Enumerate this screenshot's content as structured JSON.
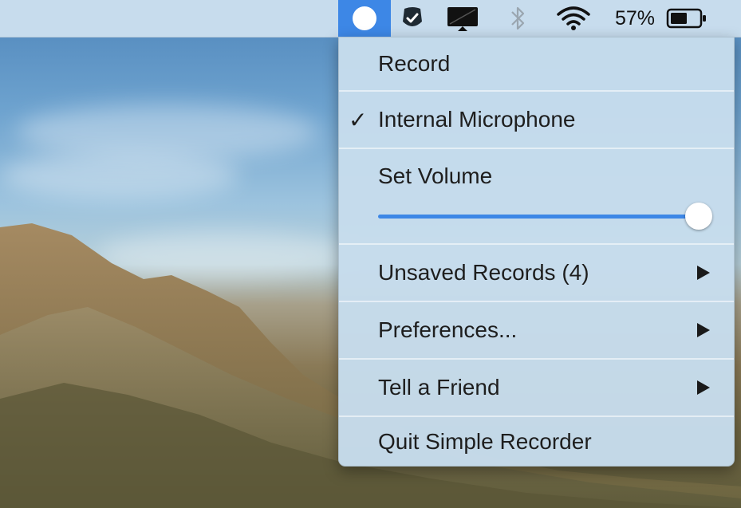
{
  "menubar": {
    "battery_percent": "57%",
    "icons": [
      "simple-recorder-icon",
      "checkmark-shield-icon",
      "display-icon",
      "bluetooth-icon",
      "wifi-icon",
      "battery-icon"
    ]
  },
  "menu": {
    "record": "Record",
    "check_mark": "✓",
    "internal_microphone": "Internal Microphone",
    "set_volume": "Set Volume",
    "volume_level": 1.0,
    "unsaved_records": "Unsaved Records (4)",
    "preferences": "Preferences...",
    "tell_a_friend": "Tell a Friend",
    "quit": "Quit Simple Recorder"
  },
  "colors": {
    "accent": "#3d87e6",
    "menu_bg": "#c6dcec"
  }
}
